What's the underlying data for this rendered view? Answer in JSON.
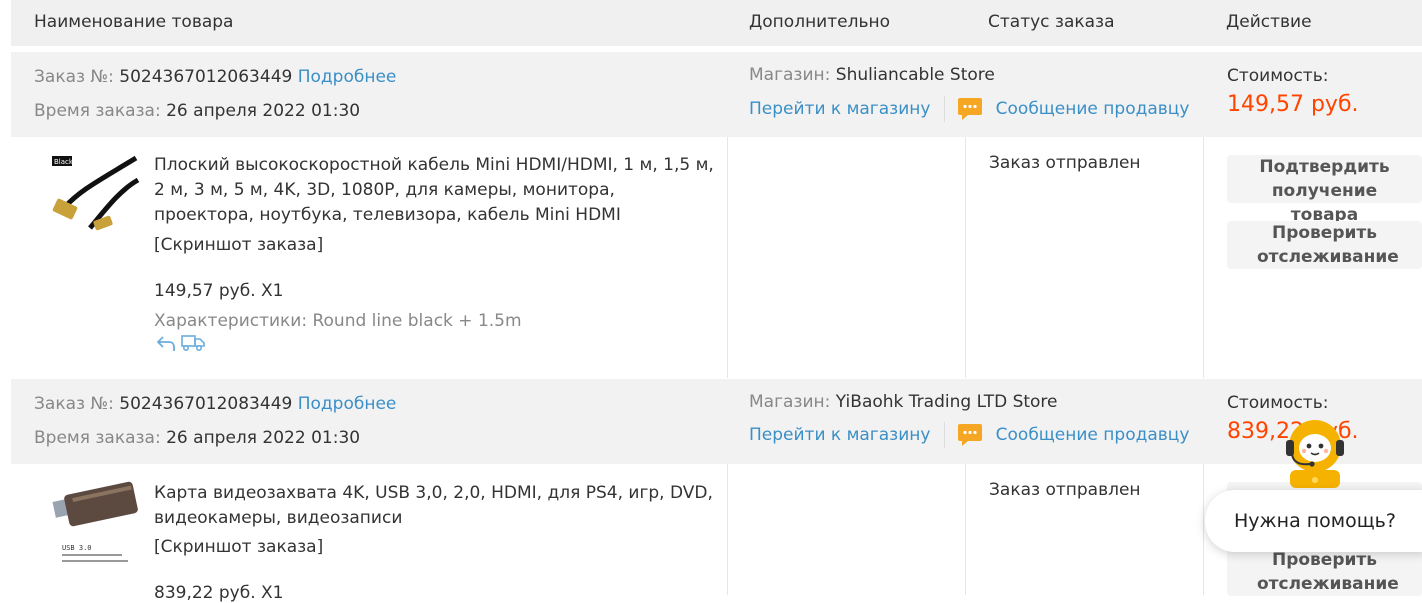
{
  "header": {
    "col_product": "Наименование товара",
    "col_extra": "Дополнительно",
    "col_status": "Статус заказа",
    "col_action": "Действие"
  },
  "orders": [
    {
      "order_label": "Заказ №:",
      "order_number": "5024367012063449",
      "details_link": "Подробнее",
      "time_label": "Время заказа:",
      "time_value": "26 апреля 2022 01:30",
      "store_label": "Магазин:",
      "store_name": "Shuliancable Store",
      "go_to_store": "Перейти к магазину",
      "message_seller": "Сообщение продавцу",
      "cost_label": "Стоимость:",
      "cost_value": "149,57 руб.",
      "product_title": "Плоский высокоскоростной кабель Mini HDMI/HDMI, 1 м, 1,5 м, 2 м, 3 м, 5 м, 4K, 3D, 1080P, для камеры, монитора, проектора, ноутбука, телевизора, кабель Mini HDMI",
      "snapshot": "[Скриншот заказа]",
      "price_qty": "149,57 руб. X1",
      "specs": "Характеристики: Round line black + 1.5m",
      "thumb_tag": "Black",
      "status": "Заказ отправлен",
      "btn_confirm": "Подтвердить получение товара",
      "btn_track": "Проверить отслеживание"
    },
    {
      "order_label": "Заказ №:",
      "order_number": "5024367012083449",
      "details_link": "Подробнее",
      "time_label": "Время заказа:",
      "time_value": "26 апреля 2022 01:30",
      "store_label": "Магазин:",
      "store_name": "YiBaohk Trading LTD Store",
      "go_to_store": "Перейти к магазину",
      "message_seller": "Сообщение продавцу",
      "cost_label": "Стоимость:",
      "cost_value": "839,22 руб.",
      "product_title": "Карта видеозахвата 4K, USB 3,0, 2,0, HDMI, для PS4, игр, DVD, видеокамеры, видеозаписи",
      "snapshot": "[Скриншот заказа]",
      "price_qty": "839,22 руб. X1",
      "thumb_label": "USB 3.0",
      "status": "Заказ отправлен",
      "btn_track": "Проверить отслеживание"
    }
  ],
  "help_widget": {
    "text": "Нужна помощь?"
  },
  "colors": {
    "price": "#ff4400",
    "link": "#3a8fc7",
    "band": "#f2f2f2",
    "chat_icon": "#f5a623"
  }
}
